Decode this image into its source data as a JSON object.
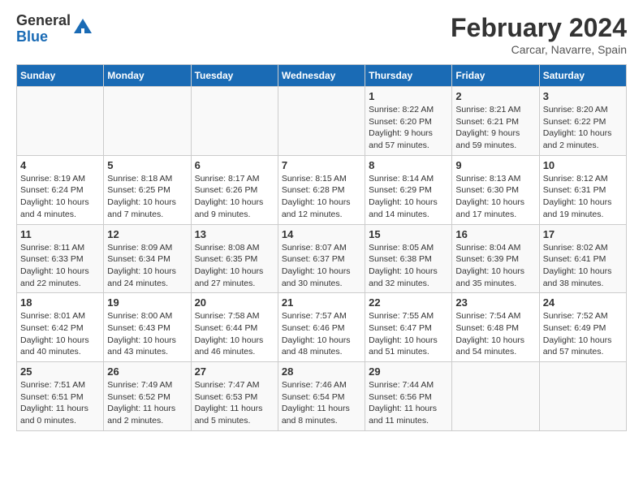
{
  "header": {
    "logo_general": "General",
    "logo_blue": "Blue",
    "title": "February 2024",
    "subtitle": "Carcar, Navarre, Spain"
  },
  "columns": [
    "Sunday",
    "Monday",
    "Tuesday",
    "Wednesday",
    "Thursday",
    "Friday",
    "Saturday"
  ],
  "weeks": [
    {
      "row_bg": "light",
      "days": [
        {
          "number": "",
          "info": ""
        },
        {
          "number": "",
          "info": ""
        },
        {
          "number": "",
          "info": ""
        },
        {
          "number": "",
          "info": ""
        },
        {
          "number": "1",
          "info": "Sunrise: 8:22 AM\nSunset: 6:20 PM\nDaylight: 9 hours\nand 57 minutes."
        },
        {
          "number": "2",
          "info": "Sunrise: 8:21 AM\nSunset: 6:21 PM\nDaylight: 9 hours\nand 59 minutes."
        },
        {
          "number": "3",
          "info": "Sunrise: 8:20 AM\nSunset: 6:22 PM\nDaylight: 10 hours\nand 2 minutes."
        }
      ]
    },
    {
      "row_bg": "white",
      "days": [
        {
          "number": "4",
          "info": "Sunrise: 8:19 AM\nSunset: 6:24 PM\nDaylight: 10 hours\nand 4 minutes."
        },
        {
          "number": "5",
          "info": "Sunrise: 8:18 AM\nSunset: 6:25 PM\nDaylight: 10 hours\nand 7 minutes."
        },
        {
          "number": "6",
          "info": "Sunrise: 8:17 AM\nSunset: 6:26 PM\nDaylight: 10 hours\nand 9 minutes."
        },
        {
          "number": "7",
          "info": "Sunrise: 8:15 AM\nSunset: 6:28 PM\nDaylight: 10 hours\nand 12 minutes."
        },
        {
          "number": "8",
          "info": "Sunrise: 8:14 AM\nSunset: 6:29 PM\nDaylight: 10 hours\nand 14 minutes."
        },
        {
          "number": "9",
          "info": "Sunrise: 8:13 AM\nSunset: 6:30 PM\nDaylight: 10 hours\nand 17 minutes."
        },
        {
          "number": "10",
          "info": "Sunrise: 8:12 AM\nSunset: 6:31 PM\nDaylight: 10 hours\nand 19 minutes."
        }
      ]
    },
    {
      "row_bg": "light",
      "days": [
        {
          "number": "11",
          "info": "Sunrise: 8:11 AM\nSunset: 6:33 PM\nDaylight: 10 hours\nand 22 minutes."
        },
        {
          "number": "12",
          "info": "Sunrise: 8:09 AM\nSunset: 6:34 PM\nDaylight: 10 hours\nand 24 minutes."
        },
        {
          "number": "13",
          "info": "Sunrise: 8:08 AM\nSunset: 6:35 PM\nDaylight: 10 hours\nand 27 minutes."
        },
        {
          "number": "14",
          "info": "Sunrise: 8:07 AM\nSunset: 6:37 PM\nDaylight: 10 hours\nand 30 minutes."
        },
        {
          "number": "15",
          "info": "Sunrise: 8:05 AM\nSunset: 6:38 PM\nDaylight: 10 hours\nand 32 minutes."
        },
        {
          "number": "16",
          "info": "Sunrise: 8:04 AM\nSunset: 6:39 PM\nDaylight: 10 hours\nand 35 minutes."
        },
        {
          "number": "17",
          "info": "Sunrise: 8:02 AM\nSunset: 6:41 PM\nDaylight: 10 hours\nand 38 minutes."
        }
      ]
    },
    {
      "row_bg": "white",
      "days": [
        {
          "number": "18",
          "info": "Sunrise: 8:01 AM\nSunset: 6:42 PM\nDaylight: 10 hours\nand 40 minutes."
        },
        {
          "number": "19",
          "info": "Sunrise: 8:00 AM\nSunset: 6:43 PM\nDaylight: 10 hours\nand 43 minutes."
        },
        {
          "number": "20",
          "info": "Sunrise: 7:58 AM\nSunset: 6:44 PM\nDaylight: 10 hours\nand 46 minutes."
        },
        {
          "number": "21",
          "info": "Sunrise: 7:57 AM\nSunset: 6:46 PM\nDaylight: 10 hours\nand 48 minutes."
        },
        {
          "number": "22",
          "info": "Sunrise: 7:55 AM\nSunset: 6:47 PM\nDaylight: 10 hours\nand 51 minutes."
        },
        {
          "number": "23",
          "info": "Sunrise: 7:54 AM\nSunset: 6:48 PM\nDaylight: 10 hours\nand 54 minutes."
        },
        {
          "number": "24",
          "info": "Sunrise: 7:52 AM\nSunset: 6:49 PM\nDaylight: 10 hours\nand 57 minutes."
        }
      ]
    },
    {
      "row_bg": "light",
      "days": [
        {
          "number": "25",
          "info": "Sunrise: 7:51 AM\nSunset: 6:51 PM\nDaylight: 11 hours\nand 0 minutes."
        },
        {
          "number": "26",
          "info": "Sunrise: 7:49 AM\nSunset: 6:52 PM\nDaylight: 11 hours\nand 2 minutes."
        },
        {
          "number": "27",
          "info": "Sunrise: 7:47 AM\nSunset: 6:53 PM\nDaylight: 11 hours\nand 5 minutes."
        },
        {
          "number": "28",
          "info": "Sunrise: 7:46 AM\nSunset: 6:54 PM\nDaylight: 11 hours\nand 8 minutes."
        },
        {
          "number": "29",
          "info": "Sunrise: 7:44 AM\nSunset: 6:56 PM\nDaylight: 11 hours\nand 11 minutes."
        },
        {
          "number": "",
          "info": ""
        },
        {
          "number": "",
          "info": ""
        }
      ]
    }
  ]
}
